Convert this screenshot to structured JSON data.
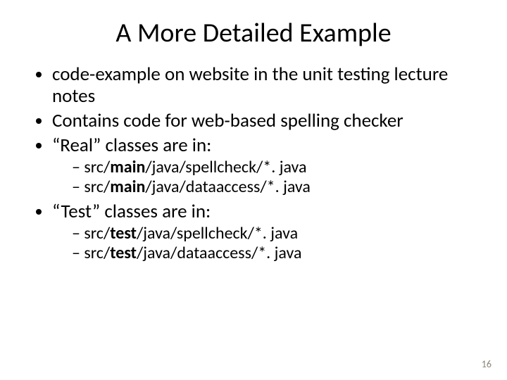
{
  "title": "A More Detailed Example",
  "bullets": {
    "b1": "code-example on website in the unit testing lecture notes",
    "b2": "Contains code for web-based spelling checker",
    "b3": "“Real” classes are in:",
    "b3s1_pre": "src/",
    "b3s1_bold": "main",
    "b3s1_post": "/java/spellcheck/*. java",
    "b3s2_pre": "src/",
    "b3s2_bold": "main",
    "b3s2_post": "/java/dataaccess/*. java",
    "b4": "“Test” classes are in:",
    "b4s1_pre": "src/",
    "b4s1_bold": "test",
    "b4s1_post": "/java/spellcheck/*. java",
    "b4s2_pre": "src/",
    "b4s2_bold": "test",
    "b4s2_post": "/java/dataaccess/*. java"
  },
  "page": "16"
}
